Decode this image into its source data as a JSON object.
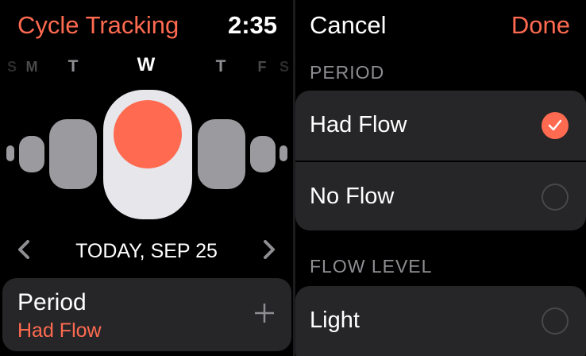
{
  "left_screen": {
    "app_title": "Cycle Tracking",
    "clock": "2:35",
    "week_days": [
      "S",
      "M",
      "T",
      "W",
      "T",
      "F",
      "S"
    ],
    "current_day_index": 3,
    "date_label": "TODAY, SEP 25",
    "period_card": {
      "title": "Period",
      "value": "Had Flow"
    },
    "colors": {
      "accent": "#ff6a50",
      "pill": "#9a9a9f",
      "pill_current": "#e6e6eb"
    },
    "icons": {
      "prev": "chevron-left-icon",
      "next": "chevron-right-icon",
      "add": "plus-icon"
    }
  },
  "right_screen": {
    "cancel_label": "Cancel",
    "done_label": "Done",
    "period_section": "PERIOD",
    "period_options": [
      {
        "label": "Had Flow",
        "selected": true
      },
      {
        "label": "No Flow",
        "selected": false
      }
    ],
    "flow_section": "FLOW LEVEL",
    "flow_options": [
      {
        "label": "Light",
        "selected": false
      }
    ],
    "colors": {
      "accent": "#ff6a50",
      "card": "#262628"
    }
  }
}
